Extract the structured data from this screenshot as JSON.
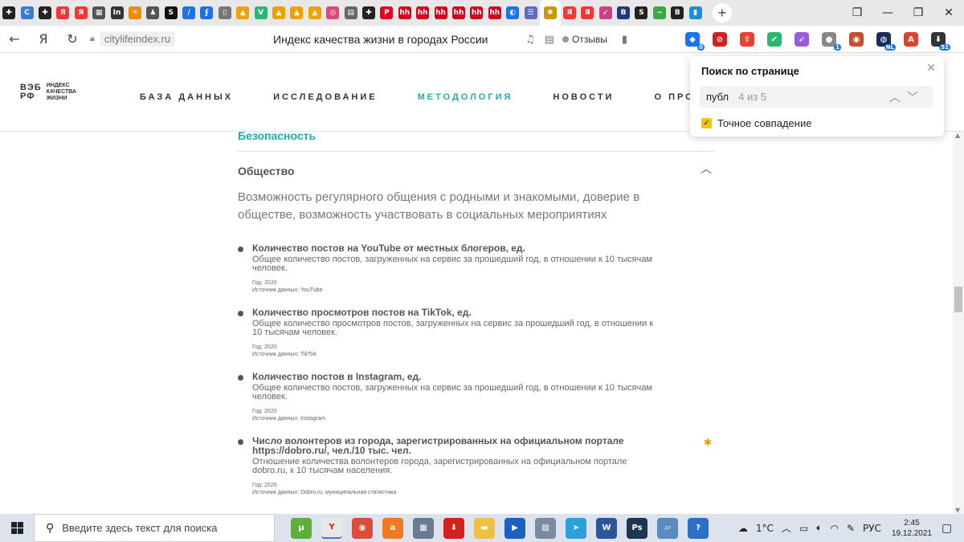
{
  "browser": {
    "tab_icons": [
      {
        "name": "tab-plus-circle",
        "glyph": "✚",
        "color": "#222222"
      },
      {
        "name": "tab-c-logo",
        "glyph": "C",
        "color": "#3a7bd5"
      },
      {
        "name": "tab-plus-circle-2",
        "glyph": "✚",
        "color": "#222222"
      },
      {
        "name": "tab-yandex",
        "glyph": "Я",
        "color": "#ff3333"
      },
      {
        "name": "tab-yandex-2",
        "glyph": "Я",
        "color": "#ff3333"
      },
      {
        "name": "tab-grid",
        "glyph": "▦",
        "color": "#555555"
      },
      {
        "name": "tab-in",
        "glyph": "In",
        "color": "#333333"
      },
      {
        "name": "tab-sun",
        "glyph": "☀",
        "color": "#f08a00"
      },
      {
        "name": "tab-person",
        "glyph": "♟",
        "color": "#555555"
      },
      {
        "name": "tab-s",
        "glyph": "S",
        "color": "#111111"
      },
      {
        "name": "tab-slash",
        "glyph": "/",
        "color": "#1a73e8"
      },
      {
        "name": "tab-f",
        "glyph": "ʄ",
        "color": "#1a73e8"
      },
      {
        "name": "tab-doc",
        "glyph": "▯",
        "color": "#777777"
      },
      {
        "name": "tab-mountain",
        "glyph": "▲",
        "color": "#f0a000"
      },
      {
        "name": "tab-v",
        "glyph": "V",
        "color": "#2bb673"
      },
      {
        "name": "tab-mountain-2",
        "glyph": "▲",
        "color": "#f0a000"
      },
      {
        "name": "tab-mountain-3",
        "glyph": "▲",
        "color": "#f0a000"
      },
      {
        "name": "tab-mountain-4",
        "glyph": "▲",
        "color": "#f0a000"
      },
      {
        "name": "tab-swirl",
        "glyph": "◎",
        "color": "#e0457b"
      },
      {
        "name": "tab-page",
        "glyph": "▤",
        "color": "#666666"
      },
      {
        "name": "tab-plus-circle-3",
        "glyph": "✚",
        "color": "#222222"
      },
      {
        "name": "tab-pinterest",
        "glyph": "P",
        "color": "#e60023"
      },
      {
        "name": "tab-hh",
        "glyph": "hh",
        "color": "#d6001c"
      },
      {
        "name": "tab-hh-2",
        "glyph": "hh",
        "color": "#d6001c"
      },
      {
        "name": "tab-hh-3",
        "glyph": "hh",
        "color": "#d6001c"
      },
      {
        "name": "tab-hh-4",
        "glyph": "hh",
        "color": "#d6001c"
      },
      {
        "name": "tab-hh-5",
        "glyph": "hh",
        "color": "#d6001c"
      },
      {
        "name": "tab-hh-6",
        "glyph": "hh",
        "color": "#d6001c"
      },
      {
        "name": "tab-wave",
        "glyph": "◐",
        "color": "#1a73e8"
      },
      {
        "name": "tab-list",
        "glyph": "☰",
        "color": "#5c6bc0"
      },
      {
        "name": "tab-flower-active",
        "glyph": "✱",
        "color": "#c89a00"
      },
      {
        "name": "tab-yandex-3",
        "glyph": "Я",
        "color": "#ff3333"
      },
      {
        "name": "tab-yandex-4",
        "glyph": "Я",
        "color": "#ff3333"
      },
      {
        "name": "tab-feather",
        "glyph": "➶",
        "color": "#d04080"
      },
      {
        "name": "tab-hse",
        "glyph": "В",
        "color": "#233a7a"
      },
      {
        "name": "tab-s-2",
        "glyph": "S",
        "color": "#222222"
      },
      {
        "name": "tab-green",
        "glyph": "~",
        "color": "#3aa845"
      },
      {
        "name": "tab-b",
        "glyph": "B",
        "color": "#222222"
      },
      {
        "name": "tab-book",
        "glyph": "▮",
        "color": "#1a8fd6"
      }
    ],
    "new_tab_glyph": "+",
    "url_domain": "citylifeindex.ru",
    "page_title": "Индекс качества жизни в городах России",
    "reviews_label": "Отзывы",
    "ext_icons": [
      {
        "name": "ext-notify",
        "glyph": "◆",
        "color": "#1a73e8",
        "badge": "0"
      },
      {
        "name": "ext-ban",
        "glyph": "⊘",
        "color": "#d62020",
        "badge": ""
      },
      {
        "name": "ext-upload",
        "glyph": "⇧",
        "color": "#e84030",
        "badge": ""
      },
      {
        "name": "ext-shield",
        "glyph": "✔",
        "color": "#2bb673",
        "badge": ""
      },
      {
        "name": "ext-feather",
        "glyph": "➶",
        "color": "#9b5bd6",
        "badge": ""
      },
      {
        "name": "ext-chat",
        "glyph": "●",
        "color": "#888888",
        "badge": "1"
      },
      {
        "name": "ext-globe",
        "glyph": "◉",
        "color": "#c05030",
        "badge": ""
      },
      {
        "name": "ext-nl",
        "glyph": "◍",
        "color": "#1b2a5a",
        "badge": "NL"
      },
      {
        "name": "ext-pdf",
        "glyph": "A",
        "color": "#e04030",
        "badge": ""
      },
      {
        "name": "ext-download",
        "glyph": "⬇",
        "color": "#333333",
        "badge": "51"
      }
    ]
  },
  "site": {
    "logo_mark": "ВЭБ\nРФ",
    "logo_lines": [
      "ИНДЕКС",
      "КАЧЕСТВА",
      "ЖИЗНИ"
    ],
    "menu": [
      {
        "label": "БАЗА ДАННЫХ",
        "active": false
      },
      {
        "label": "ИССЛЕДОВАНИЕ",
        "active": false
      },
      {
        "label": "МЕТОДОЛОГИЯ",
        "active": true
      },
      {
        "label": "НОВОСТИ",
        "active": false
      },
      {
        "label": "О ПРОЕК",
        "active": false
      }
    ]
  },
  "find": {
    "title": "Поиск по странице",
    "query": "публ",
    "count": "4 из 5",
    "exact_label": "Точное совпадение",
    "exact_checked": true
  },
  "content": {
    "prev_section": "Безопасность",
    "section_title": "Общество",
    "section_desc": "Возможность регулярного общения с родными и знакомыми, доверие в обществе, возможность участвовать в социальных мероприятиях",
    "items": [
      {
        "title": "Количество постов на YouTube от местных блогеров, ед.",
        "desc": "Общее количество постов, загруженных на сервис за прошедший год, в отношении к 10 тысячам человек.",
        "year": "Год: 2020",
        "source": "Источник данных: YouTube"
      },
      {
        "title": "Количество просмотров постов на TikTok, ед.",
        "desc": "Общее количество просмотров постов, загруженных на сервис за прошедший год, в отношении к 10 тысячам человек.",
        "year": "Год: 2020",
        "source": "Источник данных: TikTok"
      },
      {
        "title": "Количество постов в Instagram, ед.",
        "desc": "Общее количество постов, загруженных на сервис за прошедший год, в отношении к 10 тысячам человек.",
        "year": "Год: 2020",
        "source": "Источник данных: Instagram"
      },
      {
        "title": "Число волонтеров из города, зарегистрированных на официальном портале https://dobro.ru/, чел./10 тыс. чел.",
        "desc": "Отношение количества волонтеров города, зарегистрированных на официальном портале dobro.ru, к 10 тысячам населения.",
        "year": "Год: 2020",
        "source": "Источник данных: Dobro.ru, муниципальная статистика"
      }
    ]
  },
  "taskbar": {
    "search_placeholder": "Введите здесь текст для поиска",
    "apps": [
      {
        "name": "taskbar-utorrent",
        "glyph": "μ",
        "color": "#5fae3a"
      },
      {
        "name": "taskbar-yandex-browser",
        "glyph": "Y",
        "color": "#e8e8e8"
      },
      {
        "name": "taskbar-chrome",
        "glyph": "◉",
        "color": "#dd4b39"
      },
      {
        "name": "taskbar-avast",
        "glyph": "a",
        "color": "#f07a20"
      },
      {
        "name": "taskbar-calculator",
        "glyph": "▦",
        "color": "#6a7b90"
      },
      {
        "name": "taskbar-download",
        "glyph": "⬇",
        "color": "#d62020"
      },
      {
        "name": "taskbar-folder",
        "glyph": "▬",
        "color": "#f0c040"
      },
      {
        "name": "taskbar-media",
        "glyph": "▶",
        "color": "#1a60c0"
      },
      {
        "name": "taskbar-image",
        "glyph": "▨",
        "color": "#7a8aa0"
      },
      {
        "name": "taskbar-telegram",
        "glyph": "➤",
        "color": "#2aa0dc"
      },
      {
        "name": "taskbar-word",
        "glyph": "W",
        "color": "#2b579a"
      },
      {
        "name": "taskbar-photoshop",
        "glyph": "Ps",
        "color": "#1c3550"
      },
      {
        "name": "taskbar-files",
        "glyph": "▱",
        "color": "#5a8ac0"
      },
      {
        "name": "taskbar-help",
        "glyph": "?",
        "color": "#2a70c8"
      }
    ],
    "temperature": "1°C",
    "lang": "РУС",
    "time": "2:45",
    "date": "19.12.2021"
  }
}
